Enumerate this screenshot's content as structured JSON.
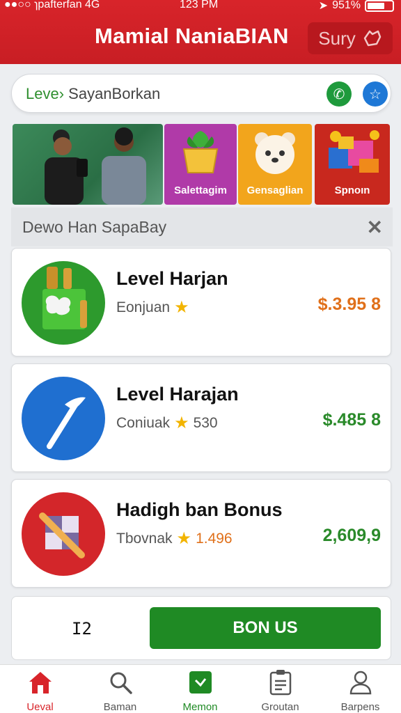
{
  "status_bar": {
    "left": "●●○○ ɿpafterfan 4G",
    "time": "123 PM",
    "battery": "951%"
  },
  "header": {
    "title": "Mamial NaniaBIAN",
    "action_label": "Sury"
  },
  "search": {
    "prefix": "Leve›",
    "text": "SayanBorkan"
  },
  "banners": [
    {
      "label": "",
      "color": "#2f7a4a"
    },
    {
      "label": "Salettagim",
      "color": "#b03aa8"
    },
    {
      "label": "Gensaglian",
      "color": "#f2a51c"
    },
    {
      "label": "Spnoın",
      "color": "#c8281e"
    }
  ],
  "filter": {
    "text": "Dewo Han SapaBay"
  },
  "cards": [
    {
      "title": "Level Harjan",
      "subtitle": "Eonjuan",
      "rating": "",
      "amount": "$.3.95 8",
      "amount_color": "#e0701a",
      "icon_bg": "#2d9a2d"
    },
    {
      "title": "Level Harajan",
      "subtitle": "Coniuak",
      "rating": "530",
      "amount": "$.485 8",
      "amount_color": "#2a8a2a",
      "icon_bg": "#1f6fd0"
    },
    {
      "title": "Hadigh ban Bonus",
      "subtitle": "Tbovnak",
      "rating": "1.496",
      "amount": "2,609,9",
      "amount_color": "#2a8a2a",
      "icon_bg": "#d3262a"
    }
  ],
  "action_row": {
    "code": "I2",
    "button_label": "BON US"
  },
  "nav": [
    {
      "label": "Ueval",
      "icon": "home-icon",
      "active": true
    },
    {
      "label": "Baman",
      "icon": "search-icon",
      "active": false
    },
    {
      "label": "Memon",
      "icon": "check-icon",
      "active": false
    },
    {
      "label": "Groutan",
      "icon": "clipboard-icon",
      "active": false
    },
    {
      "label": "Barpens",
      "icon": "user-icon",
      "active": false
    }
  ],
  "colors": {
    "brand_red": "#d8242a",
    "green": "#1f8a24",
    "blue": "#1f6fd0"
  }
}
